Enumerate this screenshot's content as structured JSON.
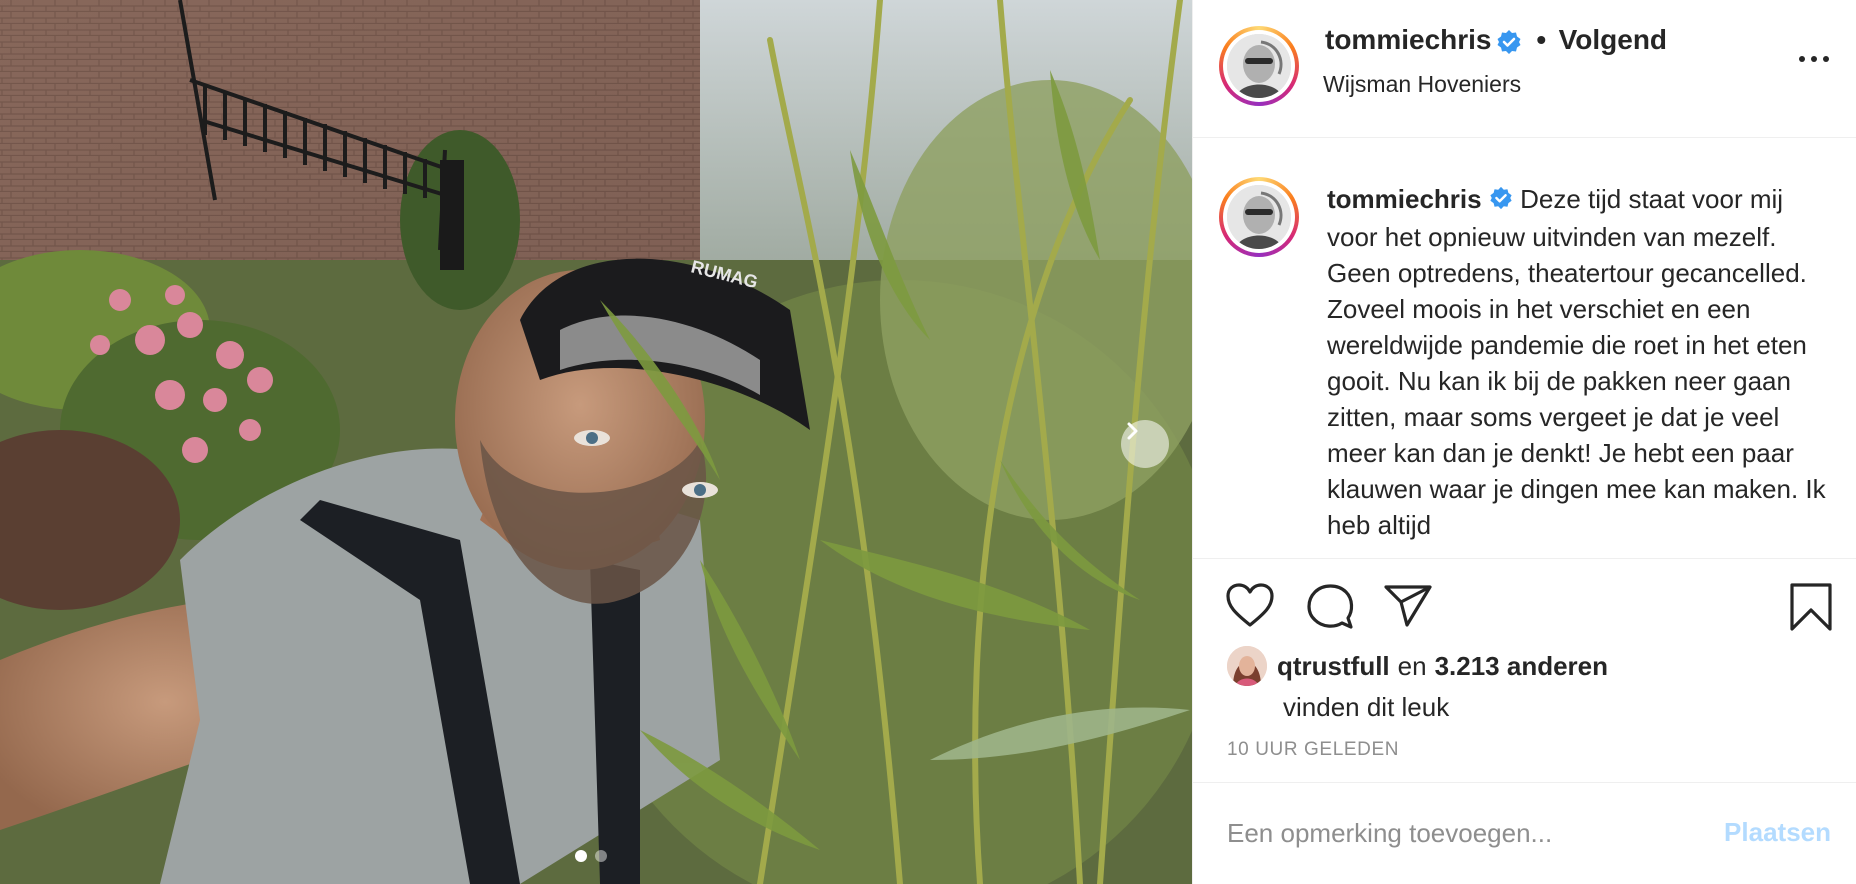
{
  "post": {
    "image_alt": "Selfie van tommiechris in een tuin tussen wilgentakken",
    "carousel": {
      "current": 1,
      "total": 2
    }
  },
  "header": {
    "username": "tommiechris",
    "follow_separator": "•",
    "follow_label": "Volgend",
    "location": "Wijsman Hoveniers"
  },
  "caption": {
    "username": "tommiechris",
    "text": "Deze tijd staat voor mij voor het opnieuw uitvinden van mezelf. Geen optredens, theatertour gecancelled. Zoveel moois in het verschiet en een wereldwijde pandemie die roet in het eten gooit. Nu kan ik bij de pakken neer gaan zitten, maar soms vergeet je dat je veel meer kan dan je denkt! Je hebt een paar klauwen waar je dingen mee kan maken. Ik heb altijd"
  },
  "likes": {
    "user": "qtrustfull",
    "connector": "en",
    "others": "3.213 anderen",
    "suffix": "vinden dit leuk"
  },
  "timestamp": "10 UUR GELEDEN",
  "comment": {
    "placeholder": "Een opmerking toevoegen...",
    "post_label": "Plaatsen"
  },
  "colors": {
    "verified": "#3897f0",
    "post_disabled": "#b3dbff",
    "muted": "#8e8e8e"
  }
}
